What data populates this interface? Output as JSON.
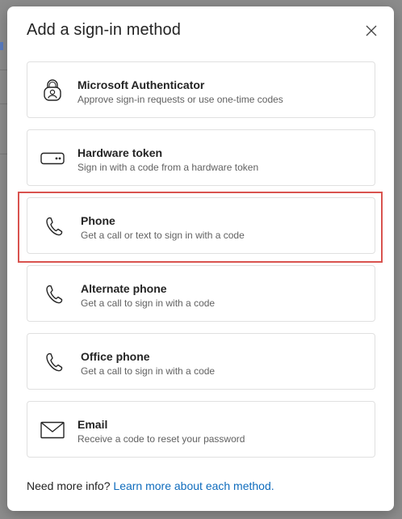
{
  "dialog": {
    "title": "Add a sign-in method",
    "close_label": "Close"
  },
  "methods": [
    {
      "id": "authenticator",
      "icon": "authenticator-lock-icon",
      "title": "Microsoft Authenticator",
      "description": "Approve sign-in requests or use one-time codes"
    },
    {
      "id": "hardware-token",
      "icon": "hardware-token-icon",
      "title": "Hardware token",
      "description": "Sign in with a code from a hardware token"
    },
    {
      "id": "phone",
      "icon": "phone-icon",
      "title": "Phone",
      "description": "Get a call or text to sign in with a code",
      "highlighted": true
    },
    {
      "id": "alternate-phone",
      "icon": "phone-icon",
      "title": "Alternate phone",
      "description": "Get a call to sign in with a code"
    },
    {
      "id": "office-phone",
      "icon": "phone-icon",
      "title": "Office phone",
      "description": "Get a call to sign in with a code"
    },
    {
      "id": "email",
      "icon": "mail-icon",
      "title": "Email",
      "description": "Receive a code to reset your password"
    }
  ],
  "footer": {
    "prompt": "Need more info?",
    "link_text": "Learn more about each method."
  },
  "colors": {
    "highlight": "#d9534f",
    "link": "#0f6cbd"
  }
}
